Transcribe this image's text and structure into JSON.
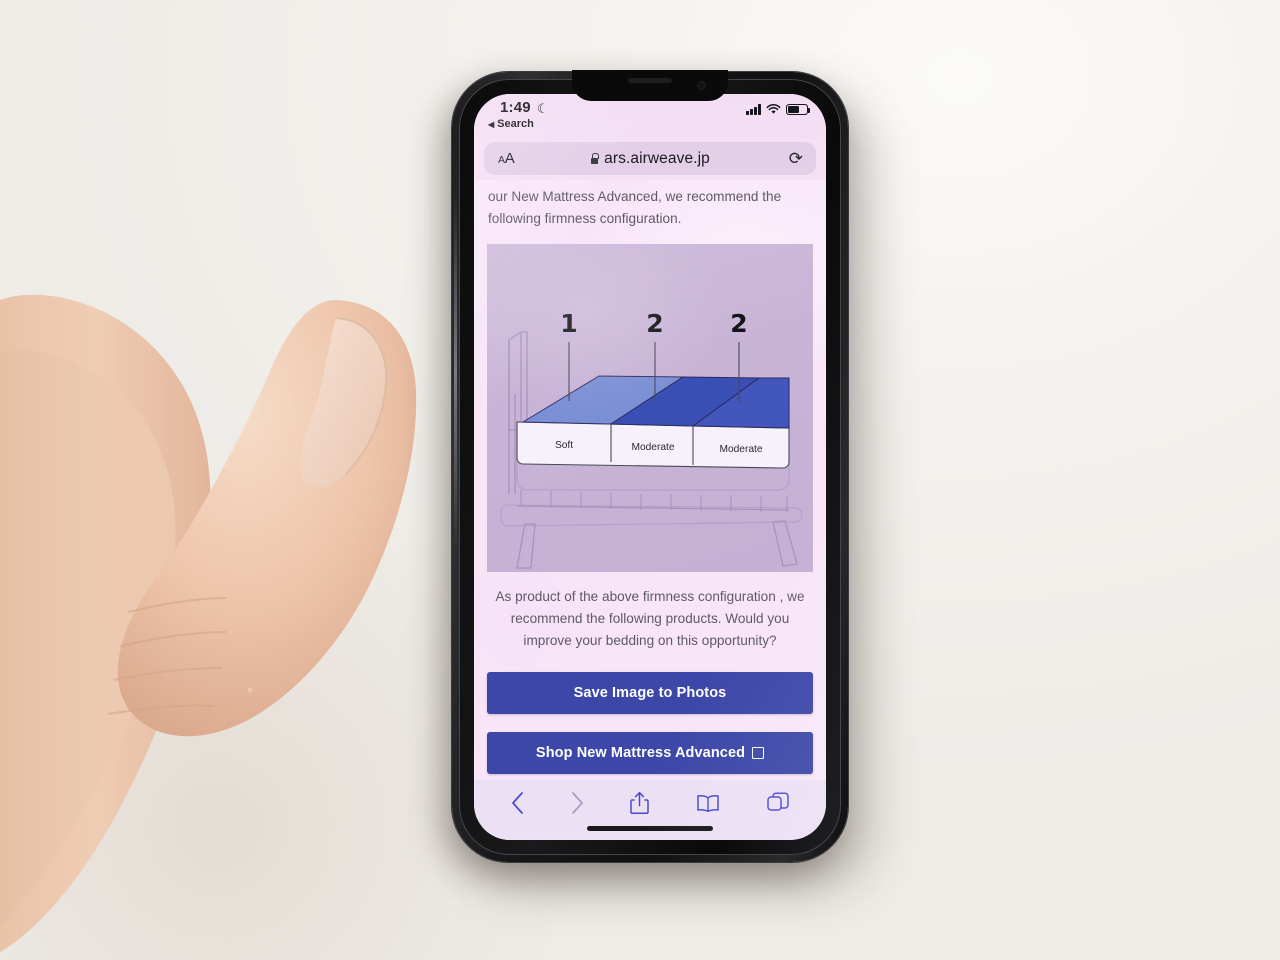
{
  "status_bar": {
    "time": "1:49",
    "moon_icon": "crescent-moon-icon",
    "back_label": "Search",
    "signal_icon": "cellular-signal-icon",
    "wifi_icon": "wifi-icon",
    "battery_icon": "battery-icon"
  },
  "browser": {
    "text_size_label": "AA",
    "lock_icon": "lock-icon",
    "url": "ars.airweave.jp",
    "reload_icon": "reload-icon",
    "toolbar": {
      "back_icon": "chevron-left-icon",
      "forward_icon": "chevron-right-icon",
      "share_icon": "share-icon",
      "bookmarks_icon": "book-icon",
      "tabs_icon": "tabs-icon"
    }
  },
  "page": {
    "intro_paragraph": "our New Mattress Advanced, we recommend the following firmness configuration.",
    "outro_paragraph": "As product of the above firmness configuration , we recommend the following products. Would you improve your bedding on this opportunity?",
    "save_button_label": "Save Image to Photos",
    "shop_button_label": "Shop New Mattress Advanced",
    "shop_button_icon": "external-link-icon"
  },
  "diagram": {
    "name": "mattress-firmness-diagram",
    "segments": [
      {
        "number": "1",
        "firmness": "Soft",
        "color": "#7b8fd4"
      },
      {
        "number": "2",
        "firmness": "Moderate",
        "color": "#3a4fb5"
      },
      {
        "number": "2",
        "firmness": "Moderate",
        "color": "#4256bb"
      }
    ],
    "panel_color": "#c8b4d6",
    "frame_color": "#a893bd"
  },
  "colors": {
    "accent_button": "#3c47a8",
    "page_background": "#f8e6f8",
    "toolbar_tint": "#4a4ad0"
  }
}
